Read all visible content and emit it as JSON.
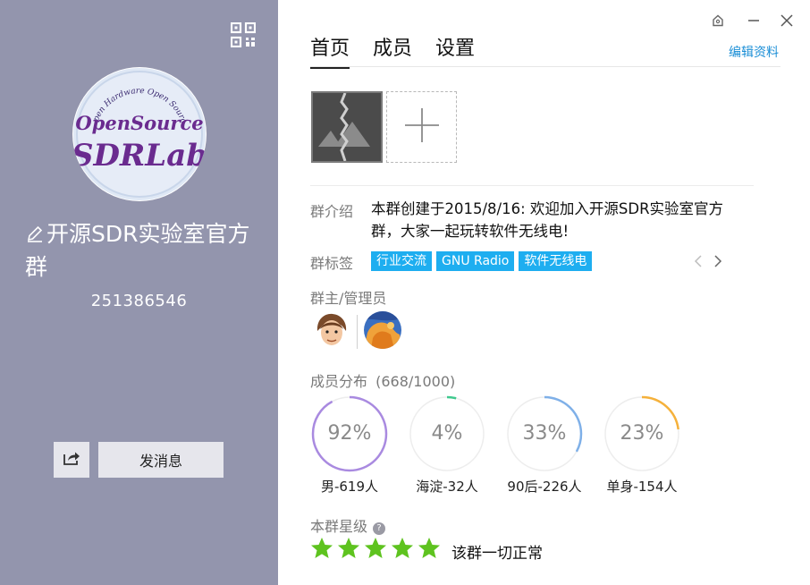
{
  "group": {
    "name": "开源SDR实验室官方群",
    "id": "251386546",
    "logo_text": {
      "top_arc": "Open Hardware Open Source",
      "line1": "OpenSource",
      "line2": "SDRLab"
    }
  },
  "actions": {
    "send_message": "发消息"
  },
  "tabs": [
    {
      "label": "首页",
      "active": true
    },
    {
      "label": "成员",
      "active": false
    },
    {
      "label": "设置",
      "active": false
    }
  ],
  "edit_profile": "编辑资料",
  "intro": {
    "label": "群介绍",
    "text": "本群创建于2015/8/16: 欢迎加入开源SDR实验室官方群，大家一起玩转软件无线电!"
  },
  "tags": {
    "label": "群标签",
    "items": [
      "行业交流",
      "GNU Radio",
      "软件无线电"
    ]
  },
  "admins": {
    "label": "群主/管理员"
  },
  "distribution": {
    "label": "成员分布",
    "count": "(668/1000)",
    "items": [
      {
        "percent": "92%",
        "value": 0.92,
        "caption": "男-619人",
        "color": "#a98ae0"
      },
      {
        "percent": "4%",
        "value": 0.04,
        "caption": "海淀-32人",
        "color": "#3fc98e"
      },
      {
        "percent": "33%",
        "value": 0.33,
        "caption": "90后-226人",
        "color": "#7fb0e8"
      },
      {
        "percent": "23%",
        "value": 0.23,
        "caption": "单身-154人",
        "color": "#f5b13b"
      }
    ]
  },
  "rating": {
    "label": "本群星级",
    "stars": 5,
    "status": "该群一切正常",
    "star_color": "#5ec31f"
  },
  "icons": {
    "qr": "qr-code-icon",
    "edit": "pencil-icon",
    "share": "share-icon",
    "skin": "skin-icon",
    "minimize": "minimize-icon",
    "close": "close-icon",
    "add": "plus-icon",
    "prev": "chevron-left-icon",
    "next": "chevron-right-icon",
    "help": "help-icon"
  }
}
